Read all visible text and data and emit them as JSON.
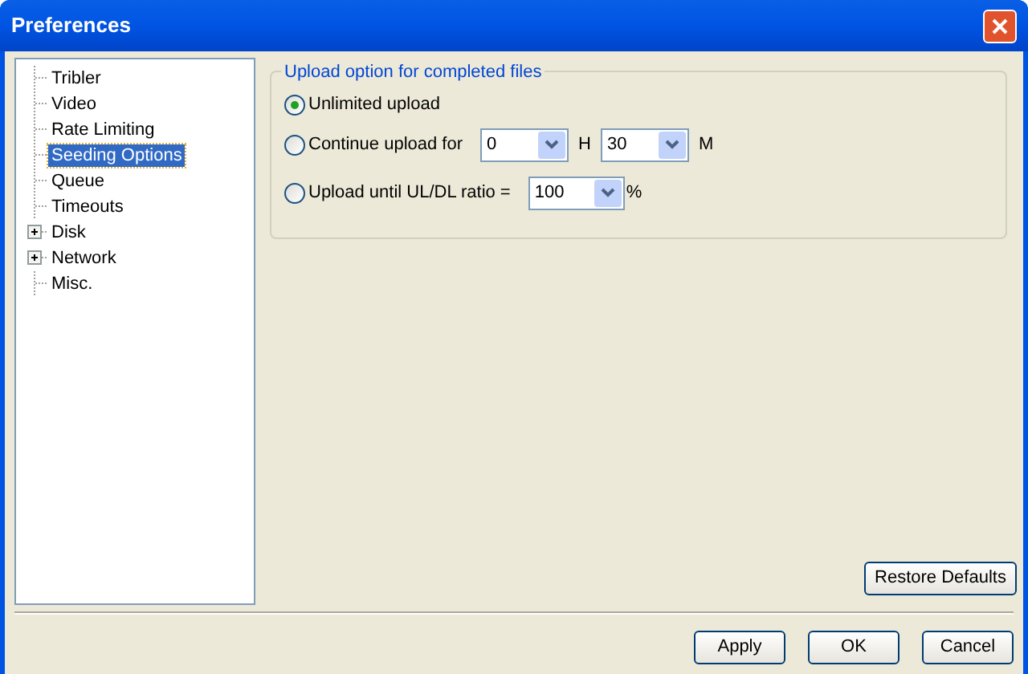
{
  "window": {
    "title": "Preferences"
  },
  "tree": [
    {
      "label": "Tribler",
      "selected": false,
      "kind": "leaf"
    },
    {
      "label": "Video",
      "selected": false,
      "kind": "leaf"
    },
    {
      "label": "Rate Limiting",
      "selected": false,
      "kind": "leaf"
    },
    {
      "label": "Seeding Options",
      "selected": true,
      "kind": "leaf"
    },
    {
      "label": "Queue",
      "selected": false,
      "kind": "leaf"
    },
    {
      "label": "Timeouts",
      "selected": false,
      "kind": "leaf"
    },
    {
      "label": "Disk",
      "selected": false,
      "kind": "folder",
      "expanded": false
    },
    {
      "label": "Network",
      "selected": false,
      "kind": "folder",
      "expanded": false
    },
    {
      "label": "Misc.",
      "selected": false,
      "kind": "leaf"
    }
  ],
  "group": {
    "title": "Upload option for completed files",
    "options": [
      {
        "kind": "plain",
        "label": "Unlimited upload",
        "selected": true
      },
      {
        "kind": "duration",
        "label": "Continue upload for",
        "selected": false,
        "hours": {
          "value": "0",
          "unit": "H"
        },
        "minutes": {
          "value": "30",
          "unit": "M"
        }
      },
      {
        "kind": "ratio",
        "label": "Upload until UL/DL ratio =",
        "selected": false,
        "ratio": {
          "value": "100",
          "unit": "%"
        }
      }
    ]
  },
  "restore_button": "Restore Defaults",
  "buttons": [
    "Apply",
    "OK",
    "Cancel"
  ]
}
